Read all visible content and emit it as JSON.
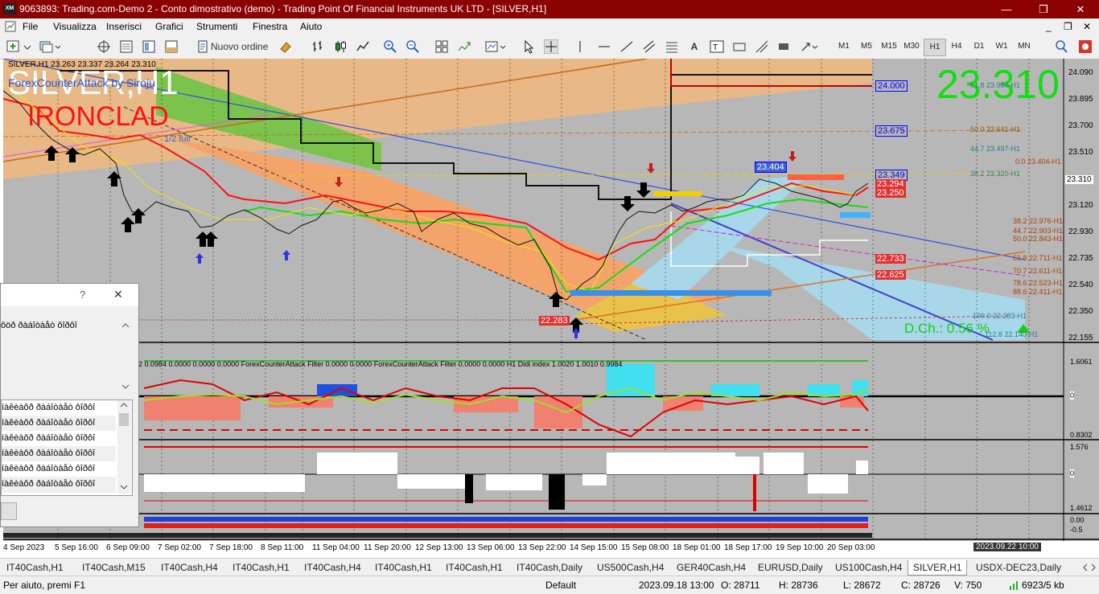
{
  "window": {
    "app_icon": "XM",
    "title": "9063893: Trading.com-Demo 2 - Conto dimostrativo (demo) - Trading Point Of Financial Instruments UK LTD - [SILVER,H1]",
    "minimize": "—",
    "restore": "❐",
    "close": "✕"
  },
  "menu": [
    "File",
    "Visualizza",
    "Inserisci",
    "Grafici",
    "Strumenti",
    "Finestra",
    "Aiuto"
  ],
  "mdi_controls": [
    "_",
    "❐",
    "✕"
  ],
  "toolbar": {
    "new_order_label": "Nuovo ordine",
    "timeframes": [
      "M1",
      "M5",
      "M15",
      "M30",
      "H1",
      "H4",
      "D1",
      "W1",
      "MN"
    ],
    "active_timeframe": "H1",
    "icons": [
      "new-chart-icon",
      "profiles-icon",
      "crosshair-move-icon",
      "market-watch-icon",
      "navigator-icon",
      "terminal-icon",
      "autotrading-icon",
      "bar-chart-icon",
      "candles-icon",
      "line-chart-icon",
      "zoom-in-icon",
      "zoom-out-icon",
      "tile-icon",
      "templates-icon",
      "cursor-icon",
      "crosshair-icon",
      "vertical-line-icon",
      "horizontal-line-icon",
      "trendline-icon",
      "channel-icon",
      "fibo-icon",
      "text-icon",
      "label-icon",
      "arrows-icon",
      "search-icon",
      "community-icon"
    ]
  },
  "chart": {
    "header_info": "SILVER,H1  23.263 23.337 23.264 23.310",
    "symbol_watermark": "SILVER,H1",
    "ea_label": "ForexCounterAttack by Siroju",
    "ironclad_label": "IRONCLAD",
    "half_label": "1/2 full",
    "big_price": "23.310",
    "price_axis": [
      "24.090",
      "23.895",
      "23.700",
      "23.510",
      "23.310",
      "23.120",
      "22.930",
      "22.735",
      "22.540",
      "22.350",
      "22.155"
    ],
    "time_axis": [
      "4 Sep 2023",
      "5 Sep 16:00",
      "6 Sep 09:00",
      "7 Sep 02:00",
      "7 Sep 18:00",
      "8 Sep 11:00",
      "11 Sep 04:00",
      "11 Sep 20:00",
      "12 Sep 13:00",
      "13 Sep 06:00",
      "13 Sep 22:00",
      "14 Sep 15:00",
      "15 Sep 08:00",
      "18 Sep 01:00",
      "18 Sep 17:00",
      "19 Sep 10:00",
      "20 Sep 03:00"
    ],
    "time_cursor_label": "2023.09.22 10:00",
    "price_boxes": [
      {
        "label": "24.000",
        "color": "#0000ff",
        "bg": "#b7b7b7"
      },
      {
        "label": "23.675",
        "color": "#0000ff",
        "bg": "#b7b7b7"
      },
      {
        "label": "23.404",
        "color": "#ffffff",
        "bg": "#3f5fd8"
      },
      {
        "label": "23.349",
        "color": "#0000ff",
        "bg": "#b7b7b7"
      },
      {
        "label": "23.310",
        "color": "#000000",
        "bg": "#ffffff"
      },
      {
        "label": "23.294",
        "color": "#ffffff",
        "bg": "#e03030"
      },
      {
        "label": "23.250",
        "color": "#ffffff",
        "bg": "#e03030"
      },
      {
        "label": "22.733",
        "color": "#ffffff",
        "bg": "#e03030"
      },
      {
        "label": "22.625",
        "color": "#ffffff",
        "bg": "#e03030"
      },
      {
        "label": "22.283",
        "color": "#ffffff",
        "bg": "#e03030"
      }
    ],
    "fib_labels": [
      {
        "text": "61.8 23.984-H1",
        "color": "#2c7b8c"
      },
      {
        "text": "50.0 23.641-H1",
        "color": "#8b5a00"
      },
      {
        "text": "44.7 23.497-H1",
        "color": "#2c7b8c"
      },
      {
        "text": "0.0 23.404-H1",
        "color": "#b04000"
      },
      {
        "text": "38.2 23.320-H1",
        "color": "#2c7b8c"
      },
      {
        "text": "38.2 22.976-H1",
        "color": "#b04000"
      },
      {
        "text": "44.7 22.903-H1",
        "color": "#b04000"
      },
      {
        "text": "50.0 22.843-H1",
        "color": "#b04000"
      },
      {
        "text": "61.8 22.711-H1",
        "color": "#b04000"
      },
      {
        "text": "70.7 22.611-H1",
        "color": "#b04000"
      },
      {
        "text": "78.6 22.523-H1",
        "color": "#b04000"
      },
      {
        "text": "88.6 22.411-H1",
        "color": "#b04000"
      },
      {
        "text": "100.0 22.283-H1",
        "color": "#2c7b8c"
      },
      {
        "text": "112.8 22.140-H1",
        "color": "#2c7b8c"
      }
    ],
    "dch_label": "D.Ch.: 0.56 %",
    "indicator1_header": "2 0.0984 0.0000 0.0000 0.0000   ForexCounterAttack Filter 0.0000 0.0000   ForexCounterAttack Filter 0.0000 0.0000   H1 Didi index 1.0020 1.0010 0.9984",
    "indicator1_axis": [
      "1.6061",
      "0",
      "0.8302"
    ],
    "indicator2_axis": [
      "1.576",
      "0",
      "1.4612"
    ],
    "indicator3_axis": [
      "0.00",
      "-0.5"
    ],
    "colors": {
      "bull": "#00e000",
      "bear": "#ff0000",
      "ironclad": "#ff2020",
      "watermark": "#ffffff",
      "ea_blue": "#1e5bd8"
    }
  },
  "dialog": {
    "help_label": "?",
    "close_label": "✕",
    "text": "ôöð ðàáîòàåò ôîðôî",
    "rows": [
      "íàêèàôð ðàáîòàåò ôîðôî",
      "íàêèàôð ðàáîòàåò ôîðôî",
      "íàêèàôð ðàáîòàåò ôîðôî",
      "íàêèàôð ðàáîòàåò ôîðôî",
      "íàêèàôð ðàáîòàåò ôîðôî",
      "íàêèàôð ðàáîòàåò ôîðôî",
      "íàêèàôð ðàáîòàåò ôîðôî"
    ]
  },
  "tabs": [
    "IT40Cash,H1",
    "IT40Cash,M15",
    "IT40Cash,H4",
    "IT40Cash,H1",
    "IT40Cash,H4",
    "IT40Cash,H1",
    "IT40Cash,H1",
    "IT40Cash,Daily",
    "US500Cash,H4",
    "GER40Cash,H4",
    "EURUSD,Daily",
    "US100Cash,H4",
    "SILVER,H1",
    "USDX-DEC23,Daily"
  ],
  "active_tab": "SILVER,H1",
  "status": {
    "help": "Per aiuto, premi F1",
    "profile": "Default",
    "datetime": "2023.09.18 13:00",
    "open": "O: 28711",
    "high": "H: 28736",
    "low": "L: 28672",
    "close": "C: 28726",
    "volume": "V: 750",
    "traffic": "6923/5 kb"
  }
}
